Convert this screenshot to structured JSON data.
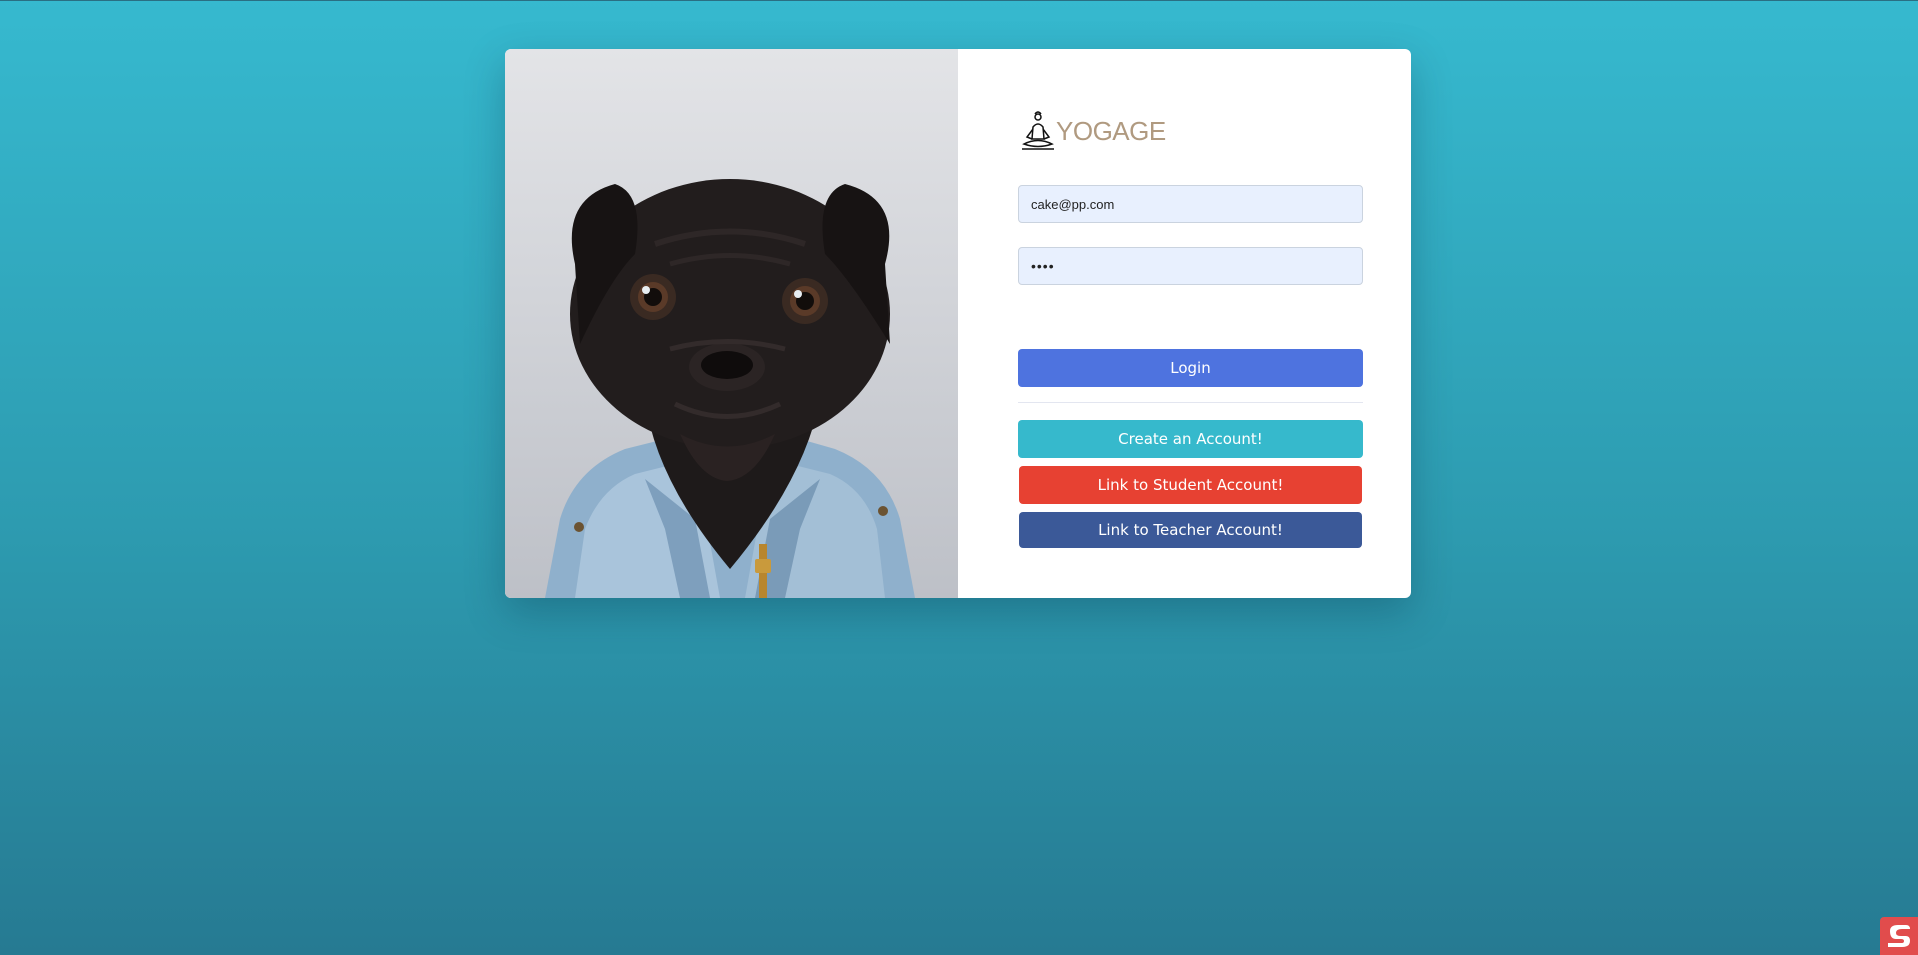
{
  "brand": {
    "name": "YOGAGE",
    "icon": "meditation-icon",
    "color": "#b09a80"
  },
  "photo": {
    "subject": "pug-photo"
  },
  "login_form": {
    "email_value": "cake@pp.com",
    "password_value": "••••",
    "login_label": "Login",
    "create_account_label": "Create an Account!",
    "student_link_label": "Link to Student Account!",
    "teacher_link_label": "Link to Teacher Account!"
  },
  "colors": {
    "login_button": "#4e73df",
    "create_button": "#36b9cc",
    "student_button": "#e74132",
    "teacher_button": "#3b5998",
    "background": "#36b9cf"
  },
  "corner_widget": {
    "icon": "extension-badge-icon"
  }
}
